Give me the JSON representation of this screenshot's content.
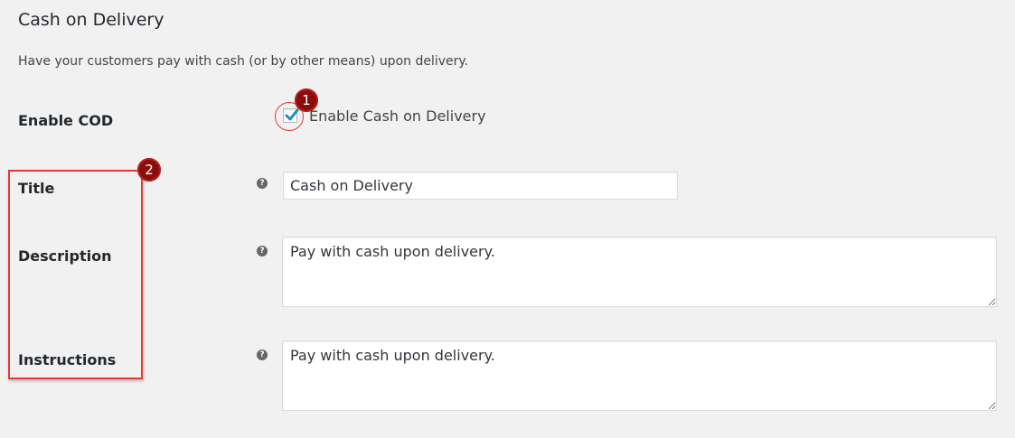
{
  "section": {
    "title": "Cash on Delivery",
    "description": "Have your customers pay with cash (or by other means) upon delivery."
  },
  "fields": {
    "enable_cod": {
      "label": "Enable COD",
      "checkbox_label": "Enable Cash on Delivery",
      "checked": true
    },
    "title": {
      "label": "Title",
      "value": "Cash on Delivery"
    },
    "description": {
      "label": "Description",
      "value": "Pay with cash upon delivery."
    },
    "instructions": {
      "label": "Instructions",
      "value": "Pay with cash upon delivery."
    }
  },
  "help_icon": "?",
  "annotations": {
    "badge_1": "1",
    "badge_2": "2",
    "color": "#e53935",
    "badge_color": "#8b0c0c"
  },
  "colors": {
    "background": "#f1f1f1",
    "checkmark": "#1e8cbe",
    "text": "#23282d"
  }
}
